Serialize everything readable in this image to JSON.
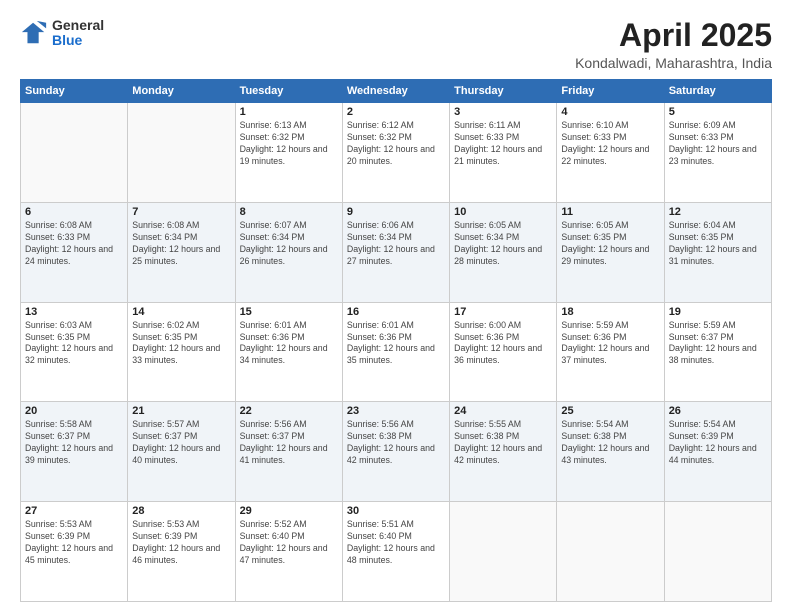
{
  "logo": {
    "general": "General",
    "blue": "Blue"
  },
  "title": {
    "month": "April 2025",
    "location": "Kondalwadi, Maharashtra, India"
  },
  "weekdays": [
    "Sunday",
    "Monday",
    "Tuesday",
    "Wednesday",
    "Thursday",
    "Friday",
    "Saturday"
  ],
  "weeks": [
    [
      {
        "day": "",
        "info": ""
      },
      {
        "day": "",
        "info": ""
      },
      {
        "day": "1",
        "info": "Sunrise: 6:13 AM\nSunset: 6:32 PM\nDaylight: 12 hours and 19 minutes."
      },
      {
        "day": "2",
        "info": "Sunrise: 6:12 AM\nSunset: 6:32 PM\nDaylight: 12 hours and 20 minutes."
      },
      {
        "day": "3",
        "info": "Sunrise: 6:11 AM\nSunset: 6:33 PM\nDaylight: 12 hours and 21 minutes."
      },
      {
        "day": "4",
        "info": "Sunrise: 6:10 AM\nSunset: 6:33 PM\nDaylight: 12 hours and 22 minutes."
      },
      {
        "day": "5",
        "info": "Sunrise: 6:09 AM\nSunset: 6:33 PM\nDaylight: 12 hours and 23 minutes."
      }
    ],
    [
      {
        "day": "6",
        "info": "Sunrise: 6:08 AM\nSunset: 6:33 PM\nDaylight: 12 hours and 24 minutes."
      },
      {
        "day": "7",
        "info": "Sunrise: 6:08 AM\nSunset: 6:34 PM\nDaylight: 12 hours and 25 minutes."
      },
      {
        "day": "8",
        "info": "Sunrise: 6:07 AM\nSunset: 6:34 PM\nDaylight: 12 hours and 26 minutes."
      },
      {
        "day": "9",
        "info": "Sunrise: 6:06 AM\nSunset: 6:34 PM\nDaylight: 12 hours and 27 minutes."
      },
      {
        "day": "10",
        "info": "Sunrise: 6:05 AM\nSunset: 6:34 PM\nDaylight: 12 hours and 28 minutes."
      },
      {
        "day": "11",
        "info": "Sunrise: 6:05 AM\nSunset: 6:35 PM\nDaylight: 12 hours and 29 minutes."
      },
      {
        "day": "12",
        "info": "Sunrise: 6:04 AM\nSunset: 6:35 PM\nDaylight: 12 hours and 31 minutes."
      }
    ],
    [
      {
        "day": "13",
        "info": "Sunrise: 6:03 AM\nSunset: 6:35 PM\nDaylight: 12 hours and 32 minutes."
      },
      {
        "day": "14",
        "info": "Sunrise: 6:02 AM\nSunset: 6:35 PM\nDaylight: 12 hours and 33 minutes."
      },
      {
        "day": "15",
        "info": "Sunrise: 6:01 AM\nSunset: 6:36 PM\nDaylight: 12 hours and 34 minutes."
      },
      {
        "day": "16",
        "info": "Sunrise: 6:01 AM\nSunset: 6:36 PM\nDaylight: 12 hours and 35 minutes."
      },
      {
        "day": "17",
        "info": "Sunrise: 6:00 AM\nSunset: 6:36 PM\nDaylight: 12 hours and 36 minutes."
      },
      {
        "day": "18",
        "info": "Sunrise: 5:59 AM\nSunset: 6:36 PM\nDaylight: 12 hours and 37 minutes."
      },
      {
        "day": "19",
        "info": "Sunrise: 5:59 AM\nSunset: 6:37 PM\nDaylight: 12 hours and 38 minutes."
      }
    ],
    [
      {
        "day": "20",
        "info": "Sunrise: 5:58 AM\nSunset: 6:37 PM\nDaylight: 12 hours and 39 minutes."
      },
      {
        "day": "21",
        "info": "Sunrise: 5:57 AM\nSunset: 6:37 PM\nDaylight: 12 hours and 40 minutes."
      },
      {
        "day": "22",
        "info": "Sunrise: 5:56 AM\nSunset: 6:37 PM\nDaylight: 12 hours and 41 minutes."
      },
      {
        "day": "23",
        "info": "Sunrise: 5:56 AM\nSunset: 6:38 PM\nDaylight: 12 hours and 42 minutes."
      },
      {
        "day": "24",
        "info": "Sunrise: 5:55 AM\nSunset: 6:38 PM\nDaylight: 12 hours and 42 minutes."
      },
      {
        "day": "25",
        "info": "Sunrise: 5:54 AM\nSunset: 6:38 PM\nDaylight: 12 hours and 43 minutes."
      },
      {
        "day": "26",
        "info": "Sunrise: 5:54 AM\nSunset: 6:39 PM\nDaylight: 12 hours and 44 minutes."
      }
    ],
    [
      {
        "day": "27",
        "info": "Sunrise: 5:53 AM\nSunset: 6:39 PM\nDaylight: 12 hours and 45 minutes."
      },
      {
        "day": "28",
        "info": "Sunrise: 5:53 AM\nSunset: 6:39 PM\nDaylight: 12 hours and 46 minutes."
      },
      {
        "day": "29",
        "info": "Sunrise: 5:52 AM\nSunset: 6:40 PM\nDaylight: 12 hours and 47 minutes."
      },
      {
        "day": "30",
        "info": "Sunrise: 5:51 AM\nSunset: 6:40 PM\nDaylight: 12 hours and 48 minutes."
      },
      {
        "day": "",
        "info": ""
      },
      {
        "day": "",
        "info": ""
      },
      {
        "day": "",
        "info": ""
      }
    ]
  ]
}
